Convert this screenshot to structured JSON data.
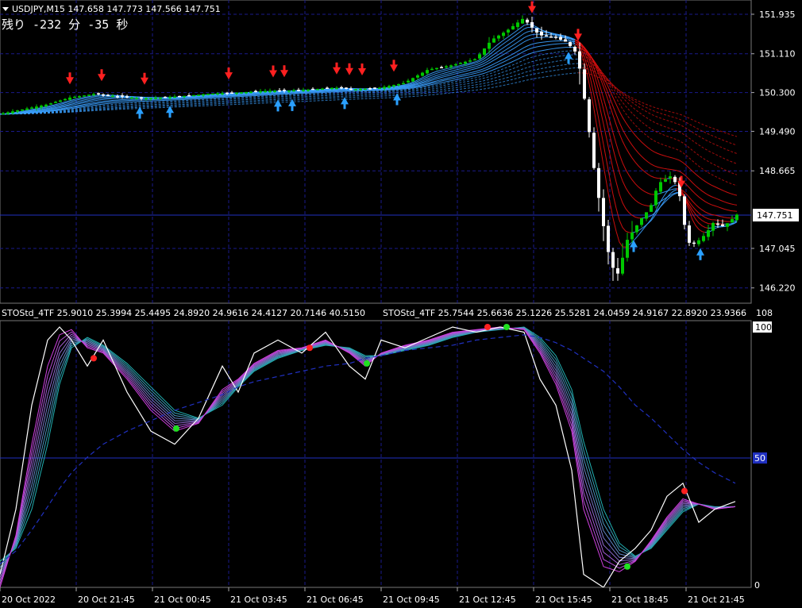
{
  "header": {
    "symbol_line": "USDJPY,M15  147.658 147.773 147.566 147.751",
    "timer_line": "残り -232 分 -35 秒"
  },
  "indicator_header": {
    "text1": "STOStd_4TF 25.9010 25.3994 25.4495 24.8920 24.9616 24.4127 20.7146 40.5150",
    "text2": "STOStd_4TF 25.7544 25.6636 25.1226 25.5281 24.0459 24.9167 22.8920 23.9366",
    "scale_top_label": "108",
    "level_100": "100",
    "level_50": "50",
    "level_0": "0"
  },
  "price_axis": {
    "ticks": [
      "151.935",
      "151.110",
      "150.300",
      "149.490",
      "148.665",
      "147.045",
      "146.220"
    ],
    "current_price": "147.751"
  },
  "time_axis": {
    "ticks": [
      "20 Oct 2022",
      "20 Oct 21:45",
      "21 Oct 00:45",
      "21 Oct 03:45",
      "21 Oct 06:45",
      "21 Oct 09:45",
      "21 Oct 12:45",
      "21 Oct 15:45",
      "21 Oct 18:45",
      "21 Oct 21:45"
    ]
  },
  "colors": {
    "background": "#000000",
    "grid": "#1a1a8c",
    "bull_candle": "#00c800",
    "bear_candle": "#ffffff",
    "up_ribbon": "#3aa0ff",
    "down_ribbon": "#e01010",
    "stoch_fast": "#ffffff",
    "stoch_mid": "#d040e0",
    "stoch_slow": "#20b0b0",
    "stoch_baseline": "#2030c0",
    "arrow_down": "#ff2020",
    "arrow_up": "#2aa0ff",
    "dot_red": "#ff2020",
    "dot_green": "#20e020"
  },
  "chart_data": [
    {
      "type": "candlestick",
      "symbol": "USDJPY",
      "timeframe": "M15",
      "ylim": [
        146.0,
        152.1
      ],
      "close_path": [
        [
          0,
          149.85
        ],
        [
          30,
          149.95
        ],
        [
          60,
          150.05
        ],
        [
          90,
          150.2
        ],
        [
          120,
          150.27
        ],
        [
          150,
          150.22
        ],
        [
          180,
          150.18
        ],
        [
          210,
          150.2
        ],
        [
          240,
          150.24
        ],
        [
          270,
          150.28
        ],
        [
          300,
          150.3
        ],
        [
          330,
          150.33
        ],
        [
          360,
          150.34
        ],
        [
          390,
          150.36
        ],
        [
          420,
          150.4
        ],
        [
          450,
          150.37
        ],
        [
          480,
          150.4
        ],
        [
          510,
          150.5
        ],
        [
          540,
          150.78
        ],
        [
          570,
          150.87
        ],
        [
          600,
          151.0
        ],
        [
          620,
          151.4
        ],
        [
          640,
          151.6
        ],
        [
          660,
          151.85
        ],
        [
          680,
          151.5
        ],
        [
          700,
          151.45
        ],
        [
          715,
          151.35
        ],
        [
          728,
          151.1
        ],
        [
          735,
          150.4
        ],
        [
          742,
          149.6
        ],
        [
          750,
          148.6
        ],
        [
          760,
          147.6
        ],
        [
          770,
          146.7
        ],
        [
          780,
          146.5
        ],
        [
          790,
          147.2
        ],
        [
          800,
          147.45
        ],
        [
          810,
          147.7
        ],
        [
          820,
          147.9
        ],
        [
          830,
          148.4
        ],
        [
          845,
          148.55
        ],
        [
          855,
          148.35
        ],
        [
          862,
          147.6
        ],
        [
          870,
          147.1
        ],
        [
          880,
          147.2
        ],
        [
          890,
          147.35
        ],
        [
          900,
          147.6
        ],
        [
          910,
          147.5
        ],
        [
          920,
          147.6
        ],
        [
          928,
          147.75
        ]
      ]
    },
    {
      "type": "line",
      "title": "STOStd_4TF",
      "ylim": [
        0,
        100
      ],
      "levels": [
        0,
        50,
        100
      ],
      "x": [
        0,
        20,
        40,
        60,
        75,
        90,
        110,
        130,
        160,
        190,
        220,
        250,
        280,
        300,
        320,
        350,
        380,
        410,
        440,
        460,
        480,
        510,
        540,
        570,
        600,
        630,
        660,
        680,
        700,
        720,
        735,
        760,
        780,
        800,
        820,
        840,
        860,
        880,
        900,
        926
      ],
      "series": [
        {
          "values": [
            5,
            30,
            70,
            95,
            100,
            95,
            85,
            95,
            75,
            60,
            55,
            65,
            85,
            75,
            90,
            95,
            90,
            98,
            85,
            80,
            95,
            92,
            96,
            100,
            98,
            100,
            98,
            80,
            70,
            45,
            5,
            0,
            10,
            15,
            22,
            35,
            40,
            25,
            30,
            33
          ]
        },
        {
          "values": [
            0,
            20,
            55,
            85,
            97,
            99,
            92,
            90,
            80,
            68,
            60,
            63,
            76,
            80,
            86,
            91,
            92,
            95,
            90,
            85,
            90,
            93,
            95,
            98,
            99,
            100,
            99,
            90,
            78,
            60,
            30,
            8,
            6,
            10,
            18,
            27,
            34,
            32,
            30,
            31
          ]
        },
        {
          "values": [
            10,
            15,
            30,
            55,
            78,
            92,
            96,
            93,
            86,
            77,
            68,
            65,
            70,
            77,
            83,
            88,
            91,
            93,
            92,
            89,
            89,
            91,
            93,
            96,
            98,
            99,
            100,
            96,
            89,
            76,
            56,
            30,
            17,
            12,
            15,
            22,
            29,
            32,
            31,
            31
          ]
        },
        {
          "values": [
            9,
            14,
            22,
            31,
            38,
            44,
            50,
            55,
            60,
            64,
            68,
            71,
            74,
            77,
            79,
            81,
            83,
            85,
            86,
            88,
            89,
            91,
            92,
            93,
            95,
            96,
            97,
            96,
            94,
            91,
            88,
            83,
            77,
            70,
            65,
            59,
            53,
            48,
            44,
            40
          ]
        }
      ]
    }
  ]
}
